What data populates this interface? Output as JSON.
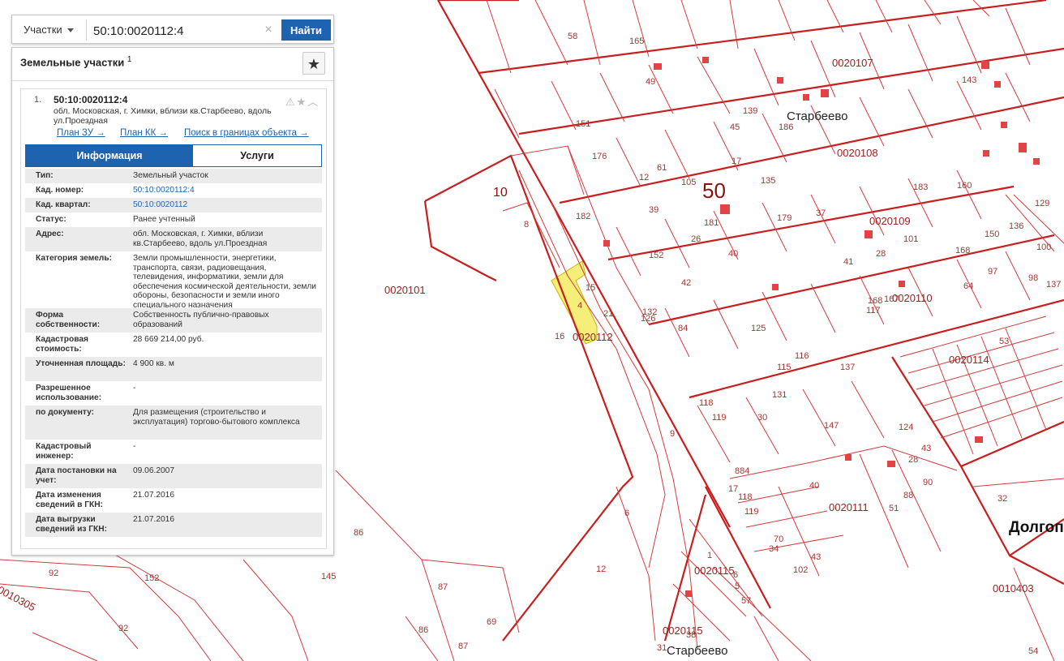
{
  "search": {
    "type_label": "Участки",
    "value": "50:10:0020112:4",
    "clear_symbol": "×",
    "find_label": "Найти"
  },
  "panel": {
    "title": "Земельные участки",
    "title_sup": "1",
    "fav_symbol": "★"
  },
  "result": {
    "index": "1.",
    "cad_number": "50:10:0020112:4",
    "address": "обл. Московская, г. Химки, вблизи кв.Старбеево, вдоль ул.Проездная",
    "icons": "⚠★︿",
    "links": [
      "План ЗУ →",
      "План КК →",
      "Поиск в границах объекта →"
    ]
  },
  "tabs": {
    "info": "Информация",
    "services": "Услуги"
  },
  "rows": [
    {
      "k": "Тип:",
      "v": "Земельный участок",
      "link": false
    },
    {
      "k": "Кад. номер:",
      "v": "50:10:0020112:4",
      "link": true
    },
    {
      "k": "Кад. квартал:",
      "v": "50:10:0020112",
      "link": true
    },
    {
      "k": "Статус:",
      "v": "Ранее учтенный",
      "link": false
    },
    {
      "k": "Адрес:",
      "v": "обл. Московская, г. Химки, вблизи кв.Старбеево, вдоль ул.Проездная",
      "link": false
    },
    {
      "k": "Категория земель:",
      "v": "Земли промышленности, энергетики, транспорта, связи, радиовещания, телевидения, информатики, земли для обеспечения космической деятельности, земли обороны, безопасности и земли иного специального назначения",
      "link": false
    },
    {
      "k": "Форма собственности:",
      "v": "Собственность публично-правовых образований",
      "link": false
    },
    {
      "k": "Кадастровая стоимость:",
      "v": "28 669 214,00 руб.",
      "link": false
    },
    {
      "k": "Уточненная площадь:",
      "v": "4 900 кв. м",
      "link": false
    },
    {
      "k": "Разрешенное использование:",
      "v": "-",
      "link": false
    },
    {
      "k": "по документу:",
      "v": "Для размещения (строительство и эксплуатация) торгово-бытового комплекса",
      "link": false
    },
    {
      "k": "Кадастровый инженер:",
      "v": "-",
      "link": false
    },
    {
      "k": "Дата постановки на учет:",
      "v": "09.06.2007",
      "link": false
    },
    {
      "k": "Дата изменения сведений в ГКН:",
      "v": "21.07.2016",
      "link": false
    },
    {
      "k": "Дата выгрузки сведений из ГКН:",
      "v": "21.07.2016",
      "link": false
    }
  ],
  "map": {
    "line_color": "#c81e1e",
    "highlight_color": "#f5ef7a",
    "big_label": "50",
    "place_labels": [
      "Старбеево",
      "Старбеево",
      "Долгоп"
    ],
    "quarter_labels": [
      "0020101",
      "0020107",
      "0020108",
      "0020109",
      "0020110",
      "0020114",
      "0020111",
      "0020115",
      "0020115",
      "0010403",
      "0010305",
      "0020112"
    ],
    "parcel_labels": [
      "10",
      "8",
      "15",
      "4",
      "21",
      "16",
      "9",
      "6",
      "12",
      "86",
      "87",
      "69",
      "86",
      "87",
      "145",
      "152",
      "92",
      "92",
      "32",
      "54",
      "40",
      "30",
      "160",
      "129",
      "150",
      "136",
      "100",
      "139",
      "186",
      "58",
      "165",
      "49",
      "151",
      "176",
      "61",
      "39",
      "12",
      "182",
      "152",
      "40",
      "84",
      "126",
      "132",
      "137",
      "116",
      "115",
      "131",
      "147",
      "124",
      "28",
      "43",
      "90",
      "88",
      "51",
      "884",
      "17",
      "118",
      "119",
      "70",
      "34",
      "102",
      "43",
      "31",
      "38",
      "57",
      "5",
      "6",
      "1",
      "118",
      "119",
      "125",
      "53",
      "117",
      "167",
      "168",
      "168",
      "64",
      "97",
      "98",
      "137",
      "143",
      "135",
      "181",
      "26",
      "42",
      "17",
      "45",
      "105",
      "179",
      "37",
      "183",
      "41",
      "28",
      "101",
      "102",
      "117"
    ]
  }
}
